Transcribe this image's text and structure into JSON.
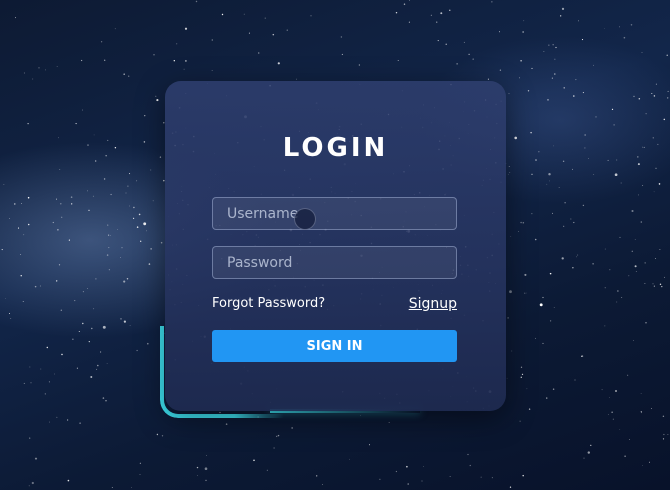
{
  "login": {
    "title": "LOGIN",
    "username_placeholder": "Username",
    "password_placeholder": "Password",
    "forgot_label": "Forgot Password?",
    "signup_label": "Signup",
    "signin_label": "SIGN IN"
  },
  "colors": {
    "accent": "#2196f3",
    "glow": "#3fe4f4",
    "background": "#0d1a33"
  },
  "icons": {
    "background": "starfield-background",
    "cursor": "mouse-cursor-indicator"
  }
}
